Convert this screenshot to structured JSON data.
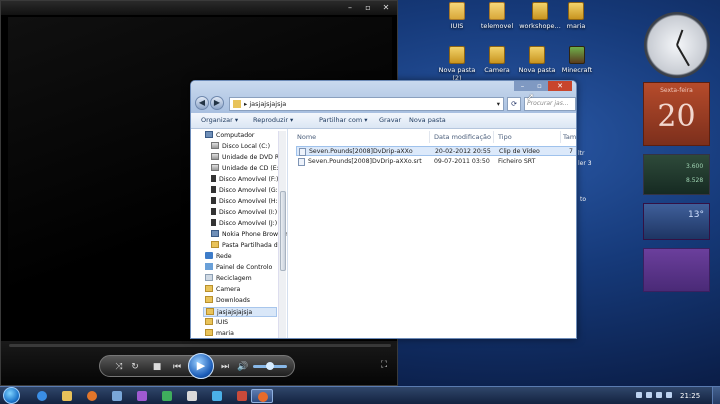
{
  "desktop_icons": [
    {
      "label": "IUIS",
      "icon": "folder-icon"
    },
    {
      "label": "telemovel",
      "icon": "folder-icon"
    },
    {
      "label": "workshope...",
      "icon": "folder-icon"
    },
    {
      "label": "maria",
      "icon": "folder-icon"
    },
    {
      "label": "Nova pasta (2)",
      "icon": "folder-icon"
    },
    {
      "label": "Camera",
      "icon": "folder-icon"
    },
    {
      "label": "Nova pasta",
      "icon": "folder-icon"
    },
    {
      "label": "Minecraft",
      "icon": "minecraft-icon"
    }
  ],
  "explorer": {
    "breadcrumb": "jasjajsjajsja",
    "search_placeholder": "Procurar jas...",
    "toolbar": {
      "organize": "Organizar ▾",
      "play": "Reproduzir ▾",
      "share": "Partilhar com ▾",
      "burn": "Gravar",
      "new_folder": "Nova pasta"
    },
    "nav_items": [
      {
        "label": "Computador",
        "icon": "computer-icon"
      },
      {
        "label": "Disco Local (C:)",
        "icon": "drive-icon"
      },
      {
        "label": "Unidade de DVD RW",
        "icon": "dvd-icon"
      },
      {
        "label": "Unidade de CD (E:)",
        "icon": "cd-icon"
      },
      {
        "label": "Disco Amovível (F:)",
        "icon": "usb-icon"
      },
      {
        "label": "Disco Amovível (G:)",
        "icon": "usb-icon"
      },
      {
        "label": "Disco Amovível (H:)",
        "icon": "usb-icon"
      },
      {
        "label": "Disco Amovível (I:)",
        "icon": "usb-icon"
      },
      {
        "label": "Disco Amovível (J:)",
        "icon": "usb-icon"
      },
      {
        "label": "Nokia Phone Browser",
        "icon": "phone-icon"
      },
      {
        "label": "Pasta Partilhada de",
        "icon": "shared-folder-icon"
      },
      {
        "label": "Rede",
        "icon": "network-icon"
      },
      {
        "label": "Painel de Controlo",
        "icon": "control-panel-icon"
      },
      {
        "label": "Reciclagem",
        "icon": "recycle-bin-icon"
      },
      {
        "label": "Camera",
        "icon": "folder-icon"
      },
      {
        "label": "Downloads",
        "icon": "folder-icon"
      },
      {
        "label": "jasjajsjajsja",
        "icon": "folder-icon"
      },
      {
        "label": "IUIS",
        "icon": "folder-icon"
      },
      {
        "label": "maria",
        "icon": "folder-icon"
      }
    ],
    "columns": [
      "Nome",
      "Data modificação",
      "Tipo",
      "Tam"
    ],
    "files": [
      {
        "name": "Seven.Pounds[2008]DvDrip-aXXo",
        "date": "20-02-2012 20:55",
        "type": "Clip de Vídeo",
        "size": "7"
      },
      {
        "name": "Seven.Pounds[2008]DvDrip-aXXo.srt",
        "date": "09-07-2011 03:50",
        "type": "Ficheiro SRT",
        "size": ""
      }
    ]
  },
  "gadgets": {
    "calendar_day": "20",
    "calendar_weekday": "Sexta-feira",
    "meter_values": [
      "3.600",
      "8.528"
    ],
    "weather_temp": "13°"
  },
  "desktop_partial_labels": [
    "ltr",
    "to",
    "ler 3"
  ],
  "taskbar": {
    "time": "21:25"
  },
  "colors": {
    "desktop_bg": "#163a7a",
    "explorer_chrome": "#b9cde8",
    "selection": "#dce9fa",
    "player_accent": "#1c5db8"
  }
}
